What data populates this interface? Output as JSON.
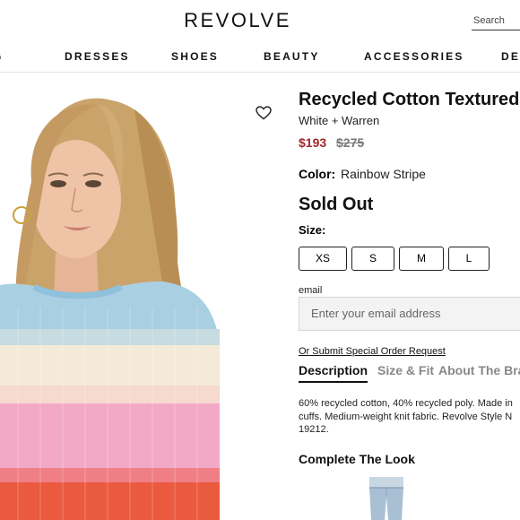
{
  "header": {
    "logo": "REVOLVE",
    "search_placeholder": "Search"
  },
  "nav": {
    "items": [
      "G",
      "DRESSES",
      "SHOES",
      "BEAUTY",
      "ACCESSORIES",
      "DES"
    ]
  },
  "product": {
    "title": "Recycled Cotton Textured",
    "brand": "White + Warren",
    "price_sale": "$193",
    "price_original": "$275",
    "color_label": "Color:",
    "color_value": "Rainbow Stripe",
    "availability": "Sold Out",
    "size_label": "Size:",
    "sizes": [
      "XS",
      "S",
      "M",
      "L"
    ],
    "email_label": "email",
    "email_placeholder": "Enter your email address",
    "special_order": "Or Submit Special Order Request",
    "tabs": [
      "Description",
      "Size & Fit",
      "About The Bra"
    ],
    "description": "60% recycled cotton, 40% recycled poly. Made in cuffs. Medium-weight knit fabric. Revolve Style N 19212.",
    "complete_look": "Complete The Look"
  },
  "colors": {
    "sale_price": "#a3272c",
    "nav_border": "#e3e3e3",
    "input_bg": "#f3f3f3"
  },
  "icons": {
    "wishlist": "heart-icon"
  }
}
